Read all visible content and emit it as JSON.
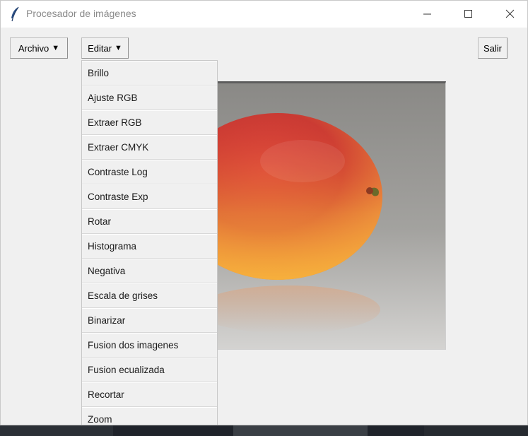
{
  "window": {
    "title": "Procesador de imágenes",
    "icon": "feather-icon"
  },
  "controls": {
    "minimize": "minimize-icon",
    "maximize": "maximize-icon",
    "close": "close-icon"
  },
  "menubar": {
    "archivo": "Archivo",
    "editar": "Editar",
    "caret": "▼",
    "salir": "Salir"
  },
  "editar_menu": {
    "items": [
      "Brillo",
      "Ajuste RGB",
      "Extraer RGB",
      "Extraer CMYK",
      "Contraste Log",
      "Contraste Exp",
      "Rotar",
      "Histograma",
      "Negativa",
      "Escala de grises",
      "Binarizar",
      "Fusion dos imagenes",
      "Fusion ecualizada",
      "Recortar",
      "Zoom"
    ]
  },
  "canvas": {
    "image_subject": "mango"
  }
}
